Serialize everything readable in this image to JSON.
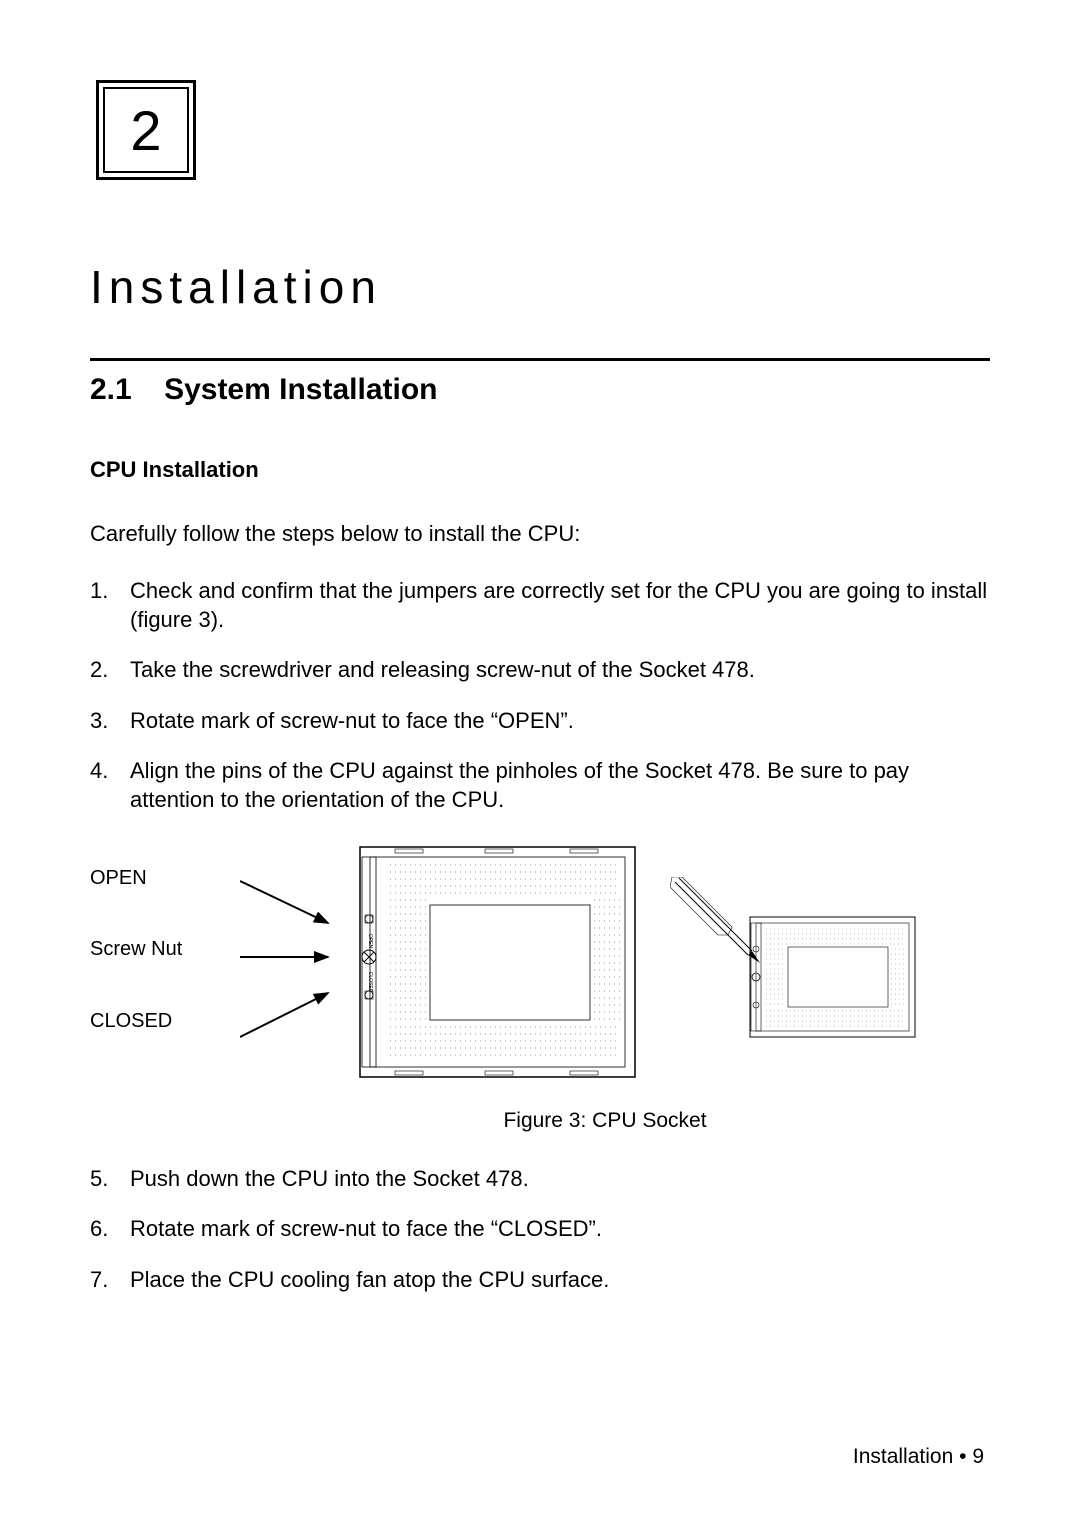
{
  "chapter": {
    "number": "2",
    "title": "Installation"
  },
  "section": {
    "number": "2.1",
    "title": "System Installation"
  },
  "subsection": {
    "title": "CPU Installation"
  },
  "intro": "Carefully follow the steps below to install the CPU:",
  "steps_a": [
    "Check and confirm that the jumpers are correctly set for the CPU you are going to install (figure 3).",
    "Take the screwdriver and releasing screw-nut of the Socket 478.",
    "Rotate mark of screw-nut to face the “OPEN”.",
    "Align the pins of the CPU against the pinholes of the Socket 478.  Be sure to pay attention to the orientation of the CPU."
  ],
  "figure": {
    "labels": {
      "open": "OPEN",
      "screw_nut": "Screw Nut",
      "closed": "CLOSED"
    },
    "caption": "Figure 3:  CPU Socket",
    "socket_text": {
      "open": "OPEN",
      "closed": "CLOSED"
    }
  },
  "steps_b_start": 5,
  "steps_b": [
    "Push down the CPU into the Socket 478.",
    "Rotate mark of screw-nut to face the “CLOSED”.",
    "Place the CPU cooling fan atop the CPU surface."
  ],
  "footer": {
    "text": "Installation",
    "bullet": "•",
    "page": "9"
  }
}
